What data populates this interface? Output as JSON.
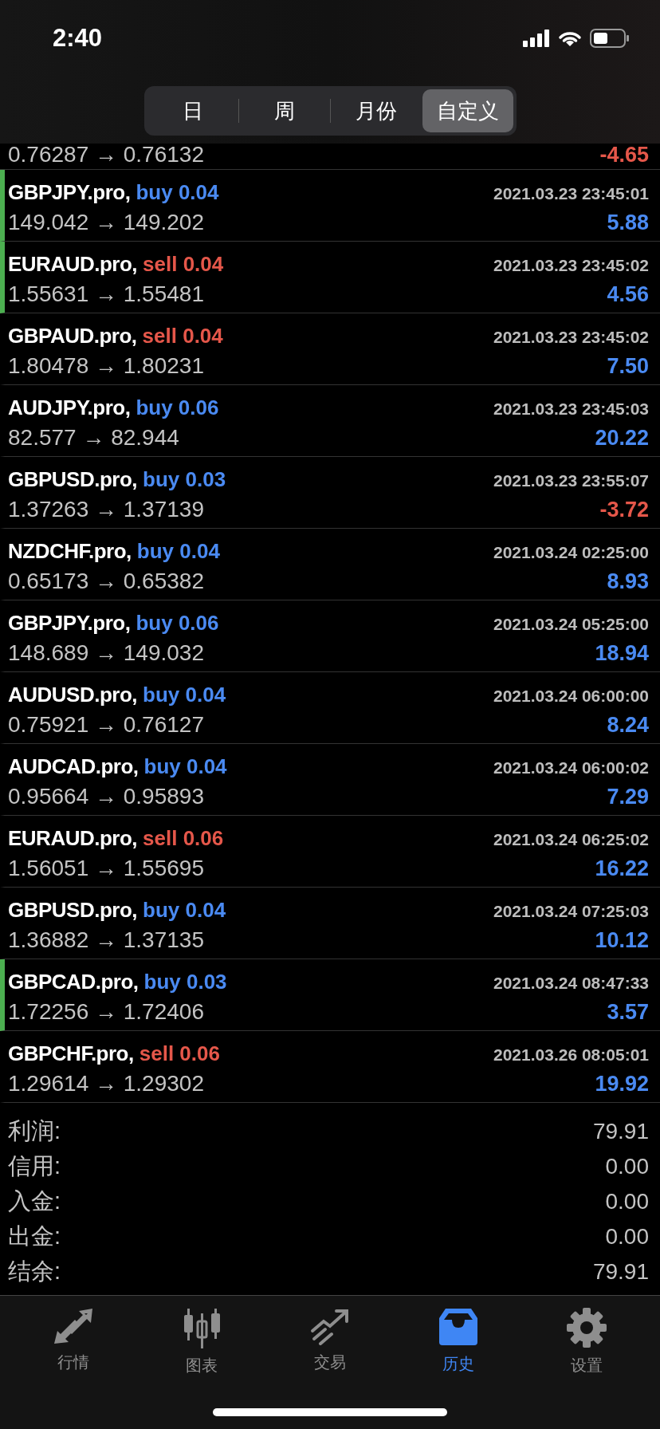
{
  "status_bar": {
    "time": "2:40"
  },
  "segments": [
    {
      "label": "日",
      "selected": false
    },
    {
      "label": "周",
      "selected": false
    },
    {
      "label": "月份",
      "selected": false
    },
    {
      "label": "自定义",
      "selected": true
    }
  ],
  "partial_row": {
    "prices": "0.76287 → 0.76132",
    "profit": "-4.65",
    "loss": true
  },
  "trades": [
    {
      "symbol": "GBPJPY.pro,",
      "kind": "buy",
      "order": "buy 0.04",
      "time": "2021.03.23 23:45:01",
      "prices": "149.042 → 149.202",
      "profit": "5.88",
      "loss": false,
      "marked": true
    },
    {
      "symbol": "EURAUD.pro,",
      "kind": "sell",
      "order": "sell 0.04",
      "time": "2021.03.23 23:45:02",
      "prices": "1.55631 → 1.55481",
      "profit": "4.56",
      "loss": false,
      "marked": true
    },
    {
      "symbol": "GBPAUD.pro,",
      "kind": "sell",
      "order": "sell 0.04",
      "time": "2021.03.23 23:45:02",
      "prices": "1.80478 → 1.80231",
      "profit": "7.50",
      "loss": false,
      "marked": false
    },
    {
      "symbol": "AUDJPY.pro,",
      "kind": "buy",
      "order": "buy 0.06",
      "time": "2021.03.23 23:45:03",
      "prices": "82.577 → 82.944",
      "profit": "20.22",
      "loss": false,
      "marked": false
    },
    {
      "symbol": "GBPUSD.pro,",
      "kind": "buy",
      "order": "buy 0.03",
      "time": "2021.03.23 23:55:07",
      "prices": "1.37263 → 1.37139",
      "profit": "-3.72",
      "loss": true,
      "marked": false
    },
    {
      "symbol": "NZDCHF.pro,",
      "kind": "buy",
      "order": "buy 0.04",
      "time": "2021.03.24 02:25:00",
      "prices": "0.65173 → 0.65382",
      "profit": "8.93",
      "loss": false,
      "marked": false
    },
    {
      "symbol": "GBPJPY.pro,",
      "kind": "buy",
      "order": "buy 0.06",
      "time": "2021.03.24 05:25:00",
      "prices": "148.689 → 149.032",
      "profit": "18.94",
      "loss": false,
      "marked": false
    },
    {
      "symbol": "AUDUSD.pro,",
      "kind": "buy",
      "order": "buy 0.04",
      "time": "2021.03.24 06:00:00",
      "prices": "0.75921 → 0.76127",
      "profit": "8.24",
      "loss": false,
      "marked": false
    },
    {
      "symbol": "AUDCAD.pro,",
      "kind": "buy",
      "order": "buy 0.04",
      "time": "2021.03.24 06:00:02",
      "prices": "0.95664 → 0.95893",
      "profit": "7.29",
      "loss": false,
      "marked": false
    },
    {
      "symbol": "EURAUD.pro,",
      "kind": "sell",
      "order": "sell 0.06",
      "time": "2021.03.24 06:25:02",
      "prices": "1.56051 → 1.55695",
      "profit": "16.22",
      "loss": false,
      "marked": false
    },
    {
      "symbol": "GBPUSD.pro,",
      "kind": "buy",
      "order": "buy 0.04",
      "time": "2021.03.24 07:25:03",
      "prices": "1.36882 → 1.37135",
      "profit": "10.12",
      "loss": false,
      "marked": false
    },
    {
      "symbol": "GBPCAD.pro,",
      "kind": "buy",
      "order": "buy 0.03",
      "time": "2021.03.24 08:47:33",
      "prices": "1.72256 → 1.72406",
      "profit": "3.57",
      "loss": false,
      "marked": true
    },
    {
      "symbol": "GBPCHF.pro,",
      "kind": "sell",
      "order": "sell 0.06",
      "time": "2021.03.26 08:05:01",
      "prices": "1.29614 → 1.29302",
      "profit": "19.92",
      "loss": false,
      "marked": false
    }
  ],
  "summary": [
    {
      "label": "利润:",
      "value": "79.91"
    },
    {
      "label": "信用:",
      "value": "0.00"
    },
    {
      "label": "入金:",
      "value": "0.00"
    },
    {
      "label": "出金:",
      "value": "0.00"
    },
    {
      "label": "结余:",
      "value": "79.91"
    }
  ],
  "tab_bar": [
    {
      "kind": "quotes",
      "label": "行情",
      "selected": false
    },
    {
      "kind": "chart",
      "label": "图表",
      "selected": false
    },
    {
      "kind": "trade",
      "label": "交易",
      "selected": false
    },
    {
      "kind": "history",
      "label": "历史",
      "selected": true
    },
    {
      "kind": "settings",
      "label": "设置",
      "selected": false
    }
  ]
}
